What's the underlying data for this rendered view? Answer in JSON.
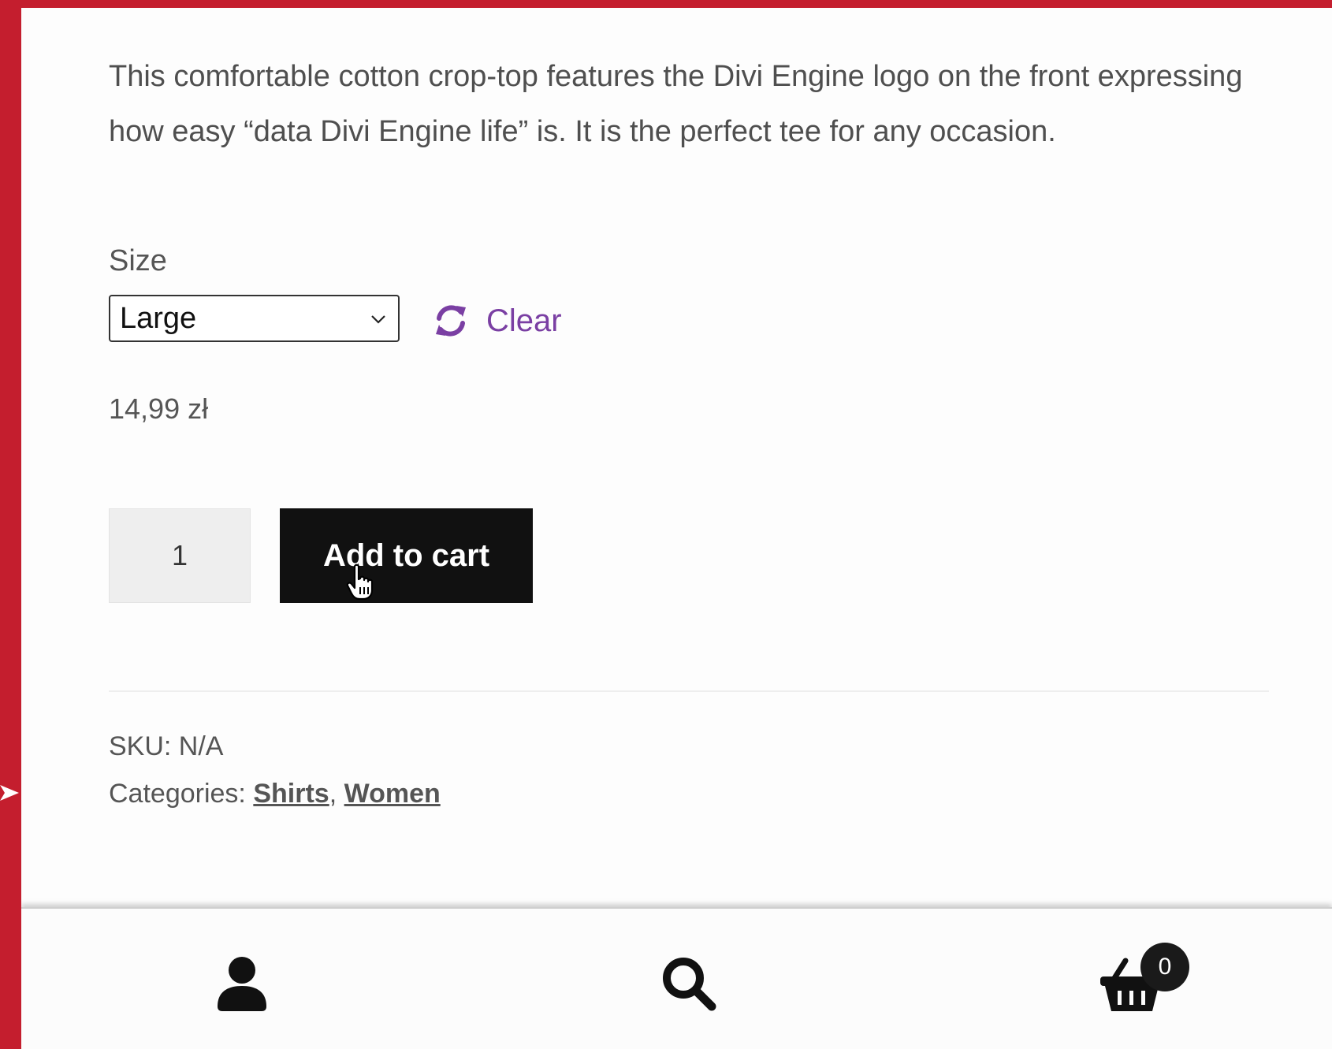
{
  "product": {
    "description": "This comfortable cotton crop-top features the Divi Engine logo on the front expressing how easy “data Divi Engine life” is. It is the perfect tee for any occasion.",
    "size_label": "Size",
    "size_selected": "Large",
    "clear_label": "Clear",
    "price": "14,99 zł",
    "quantity": "1",
    "add_to_cart_label": "Add to cart"
  },
  "meta": {
    "sku_text": "SKU: N/A",
    "categories_prefix": "Categories: ",
    "categories": [
      "Shirts",
      "Women"
    ],
    "separator": ", "
  },
  "bottom_nav": {
    "cart_count": "0",
    "icons": [
      "account-icon",
      "search-icon",
      "cart-basket-icon"
    ]
  },
  "colors": {
    "frame": "#c41e2e",
    "clear_link": "#7a3fa3",
    "button": "#111111"
  }
}
